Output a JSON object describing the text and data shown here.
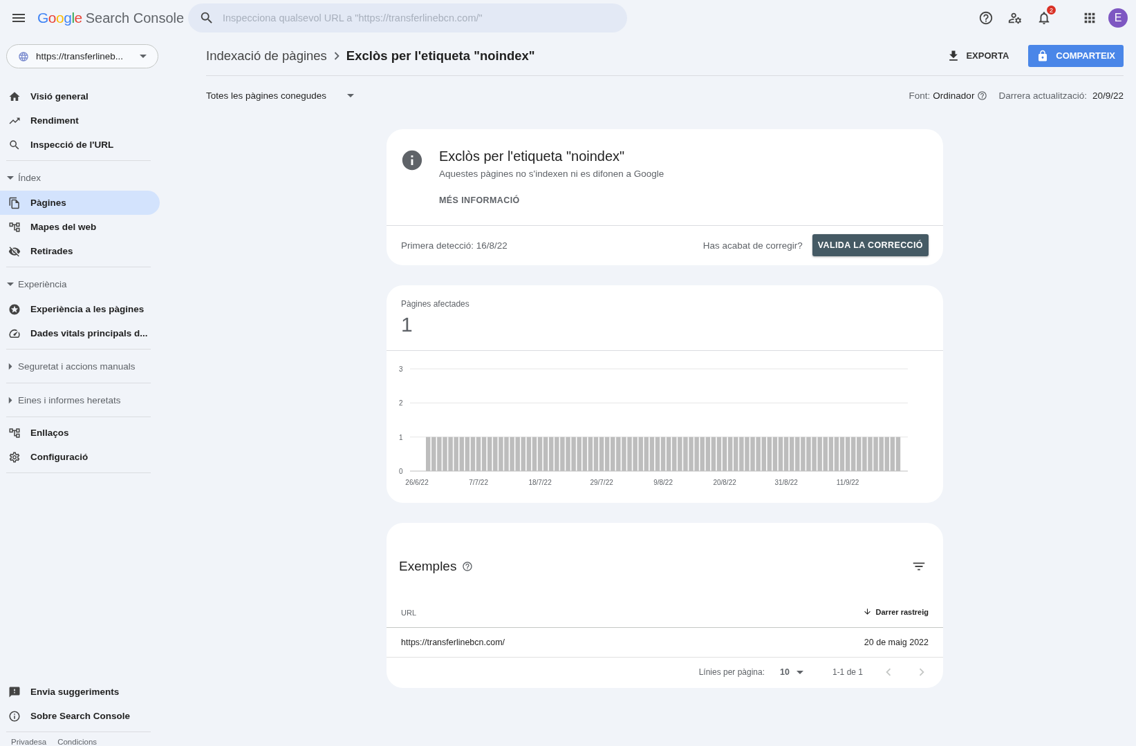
{
  "topbar": {
    "logo": "Google",
    "product": "Search Console",
    "search": {
      "placeholder": "Inspecciona qualsevol URL a \"https://transferlinebcn.com/\""
    },
    "notifications": "2",
    "avatar": "E"
  },
  "sidebar": {
    "property": "https://transferlineb...",
    "groups": [
      {
        "items": [
          {
            "label": "Visió general",
            "selected": false
          },
          {
            "label": "Rendiment",
            "selected": false
          },
          {
            "label": "Inspecció de l'URL",
            "selected": false
          }
        ]
      },
      {
        "header": {
          "label": "Índex",
          "expanded": true
        },
        "items": [
          {
            "label": "Pàgines",
            "selected": true
          },
          {
            "label": "Mapes del web",
            "selected": false
          },
          {
            "label": "Retirades",
            "selected": false
          }
        ]
      },
      {
        "header": {
          "label": "Experiència",
          "expanded": true
        },
        "items": [
          {
            "label": "Experiència a les pàgines",
            "selected": false
          },
          {
            "label": "Dades vitals principals d...",
            "selected": false
          }
        ]
      },
      {
        "header": {
          "label": "Seguretat i accions manuals",
          "expanded": false
        }
      },
      {
        "header": {
          "label": "Eines i informes heretats",
          "expanded": false
        }
      },
      {
        "items": [
          {
            "label": "Enllaços",
            "selected": false
          },
          {
            "label": "Configuració",
            "selected": false
          }
        ]
      }
    ],
    "bottom": [
      {
        "label": "Envia suggeriments",
        "selected": false
      },
      {
        "label": "Sobre Search Console",
        "selected": false
      }
    ],
    "footer": [
      "Privadesa",
      "Condicions"
    ]
  },
  "header": {
    "breadcrumb": [
      "Indexació de pàgines",
      "Exclòs per l'etiqueta \"noindex\""
    ],
    "export": "EXPORTA",
    "share": "COMPARTEIX"
  },
  "filter": {
    "value": "Totes les pàgines conegudes",
    "source_label": "Font:",
    "source": "Ordinador",
    "updated_label": "Darrera actualització:",
    "updated": "20/9/22"
  },
  "issue": {
    "title": "Exclòs per l'etiqueta \"noindex\"",
    "description": "Aquestes pàgines no s'indexen ni es difonen a Google",
    "more": "MÉS INFORMACIÓ",
    "first_detected": "Primera detecció: 16/8/22",
    "question": "Has acabat de corregir?",
    "validate": "VALIDA LA CORRECCIÓ"
  },
  "affected": {
    "label": "Pàgines afectades",
    "value": "1",
    "chart_data": {
      "type": "bar",
      "categories": [
        "26/6/22",
        null,
        null,
        null,
        null,
        null,
        null,
        null,
        null,
        null,
        null,
        "7/7/22",
        null,
        null,
        null,
        null,
        null,
        null,
        null,
        null,
        null,
        null,
        "18/7/22",
        null,
        null,
        null,
        null,
        null,
        null,
        null,
        null,
        null,
        null,
        "29/7/22",
        null,
        null,
        null,
        null,
        null,
        null,
        null,
        null,
        null,
        null,
        "9/8/22",
        null,
        null,
        null,
        null,
        null,
        null,
        null,
        null,
        null,
        null,
        "20/8/22",
        null,
        null,
        null,
        null,
        null,
        null,
        null,
        null,
        null,
        null,
        "31/8/22",
        null,
        null,
        null,
        null,
        null,
        null,
        null,
        null,
        null,
        null,
        "11/9/22",
        null,
        null,
        null,
        null,
        null,
        null,
        null,
        null,
        null
      ],
      "series": [
        {
          "color": "#bdbdbd",
          "values": [
            null,
            null,
            1,
            1,
            1,
            1,
            1,
            1,
            1,
            1,
            1,
            1,
            1,
            1,
            1,
            1,
            1,
            1,
            1,
            1,
            1,
            1,
            1,
            1,
            1,
            1,
            1,
            1,
            1,
            1,
            1,
            1,
            1,
            1,
            1,
            1,
            1,
            1,
            1,
            1,
            1,
            1,
            1,
            1,
            1,
            1,
            1,
            1,
            1,
            1,
            1,
            1,
            1,
            1,
            1,
            1,
            1,
            1,
            1,
            1,
            1,
            1,
            1,
            1,
            1,
            1,
            1,
            1,
            1,
            1,
            1,
            1,
            1,
            1,
            1,
            1,
            1,
            1,
            1,
            1,
            1,
            1,
            1,
            1,
            1,
            1,
            1
          ]
        }
      ],
      "ylim": [
        0,
        3
      ],
      "yticks": [
        0,
        1,
        2,
        3
      ]
    }
  },
  "examples": {
    "title": "Exemples",
    "columns": [
      {
        "label": "URL",
        "sorted": false
      },
      {
        "label": "Darrer rastreig",
        "sorted": true
      }
    ],
    "rows": [
      [
        "https://transferlinebcn.com/",
        "20 de maig 2022"
      ]
    ],
    "pagination": {
      "rows_label": "Línies per pàgina:",
      "rows_value": "10",
      "range": "1-1 de 1",
      "prev_disabled": true,
      "next_disabled": true
    }
  }
}
